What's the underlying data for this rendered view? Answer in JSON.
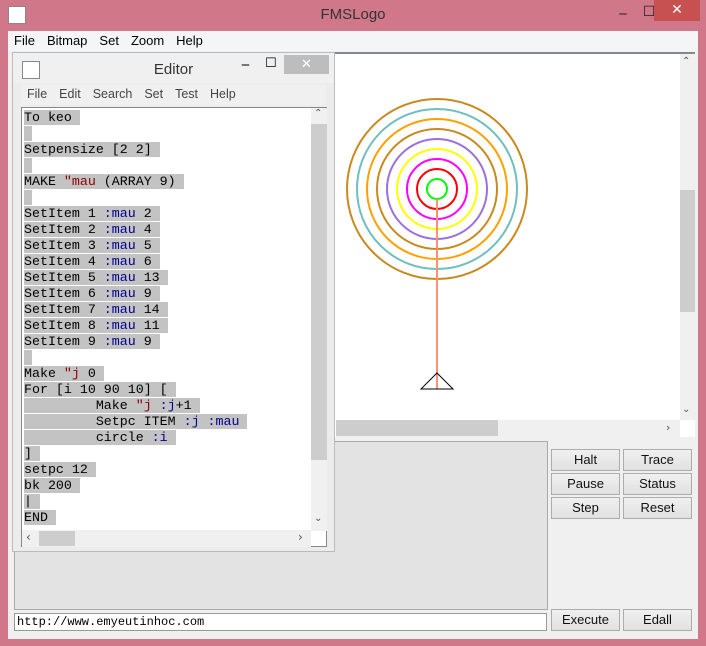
{
  "window": {
    "title": "FMSLogo",
    "minimize": "‒",
    "maximize": "☐",
    "close": "✕"
  },
  "menu": [
    "File",
    "Bitmap",
    "Set",
    "Zoom",
    "Help"
  ],
  "editor": {
    "title": "Editor",
    "menu": [
      "File",
      "Edit",
      "Search",
      "Set",
      "Test",
      "Help"
    ],
    "lines": [
      [
        [
          "To keo",
          ""
        ]
      ],
      [
        [
          "",
          ""
        ]
      ],
      [
        [
          "Setpensize [2 2]",
          ""
        ]
      ],
      [
        [
          "",
          ""
        ]
      ],
      [
        [
          "MAKE ",
          ""
        ],
        [
          "\"mau",
          "str"
        ],
        [
          " (ARRAY 9)",
          ""
        ]
      ],
      [
        [
          "",
          ""
        ]
      ],
      [
        [
          "SetItem 1 ",
          ""
        ],
        [
          ":mau",
          "var"
        ],
        [
          " 2",
          ""
        ]
      ],
      [
        [
          "SetItem 2 ",
          ""
        ],
        [
          ":mau",
          "var"
        ],
        [
          " 4",
          ""
        ]
      ],
      [
        [
          "SetItem 3 ",
          ""
        ],
        [
          ":mau",
          "var"
        ],
        [
          " 5",
          ""
        ]
      ],
      [
        [
          "SetItem 4 ",
          ""
        ],
        [
          ":mau",
          "var"
        ],
        [
          " 6",
          ""
        ]
      ],
      [
        [
          "SetItem 5 ",
          ""
        ],
        [
          ":mau",
          "var"
        ],
        [
          " 13",
          ""
        ]
      ],
      [
        [
          "SetItem 6 ",
          ""
        ],
        [
          ":mau",
          "var"
        ],
        [
          " 9",
          ""
        ]
      ],
      [
        [
          "SetItem 7 ",
          ""
        ],
        [
          ":mau",
          "var"
        ],
        [
          " 14",
          ""
        ]
      ],
      [
        [
          "SetItem 8 ",
          ""
        ],
        [
          ":mau",
          "var"
        ],
        [
          " 11",
          ""
        ]
      ],
      [
        [
          "SetItem 9 ",
          ""
        ],
        [
          ":mau",
          "var"
        ],
        [
          " 9",
          ""
        ]
      ],
      [
        [
          "",
          ""
        ]
      ],
      [
        [
          "Make ",
          ""
        ],
        [
          "\"j",
          "str"
        ],
        [
          " 0",
          ""
        ]
      ],
      [
        [
          "For [i 10 90 10] [",
          ""
        ]
      ],
      [
        [
          "         Make ",
          ""
        ],
        [
          "\"j",
          "str"
        ],
        [
          " ",
          ""
        ],
        [
          ":j",
          "var"
        ],
        [
          "+1",
          ""
        ]
      ],
      [
        [
          "         Setpc ITEM ",
          ""
        ],
        [
          ":j",
          "var"
        ],
        [
          " ",
          ""
        ],
        [
          ":mau",
          "var"
        ]
      ],
      [
        [
          "         circle ",
          ""
        ],
        [
          ":i",
          "var"
        ]
      ],
      [
        [
          "]",
          ""
        ]
      ],
      [
        [
          "setpc 12",
          ""
        ]
      ],
      [
        [
          "bk 200",
          ""
        ]
      ],
      [
        [
          "|",
          ""
        ]
      ],
      [
        [
          "END",
          ""
        ]
      ]
    ]
  },
  "drawing": {
    "circle_radii": [
      10,
      20,
      30,
      40,
      50,
      60,
      70,
      80,
      90
    ],
    "circle_colors": [
      "#00ff00",
      "#ff0000",
      "#ff00ff",
      "#ffff00",
      "#9b70de",
      "#c88a1e",
      "#ffa000",
      "#6fbfbf",
      "#c88a1e"
    ],
    "line_color": "#ff9070",
    "line_length": 200
  },
  "buttons": {
    "halt": "Halt",
    "trace": "Trace",
    "pause": "Pause",
    "status": "Status",
    "step": "Step",
    "reset": "Reset",
    "execute": "Execute",
    "edall": "Edall"
  },
  "command_input": "http://www.emyeutinhoc.com"
}
